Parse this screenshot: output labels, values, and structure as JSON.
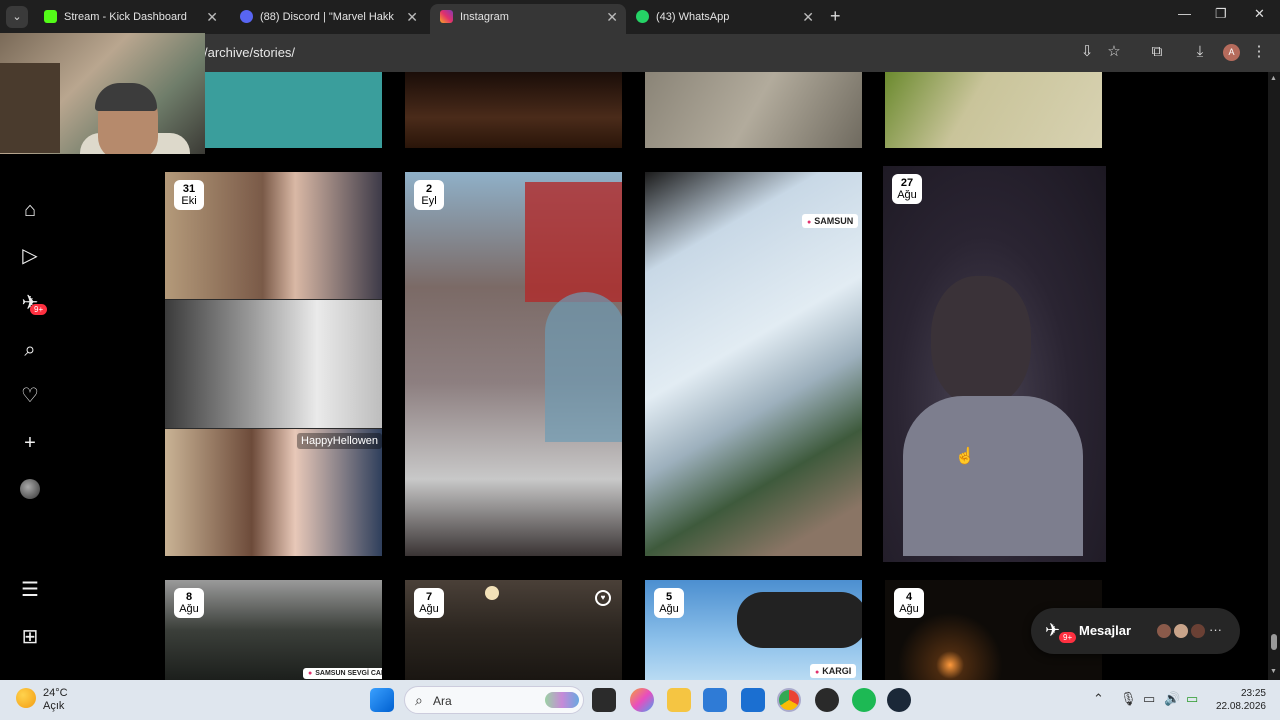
{
  "browser": {
    "tabs": [
      {
        "title": "Stream - Kick Dashboard",
        "fav_color": "#53fc18",
        "fav_text": "K"
      },
      {
        "title": "(88) Discord | \"Marvel Hakk",
        "fav_color": "#5865f2",
        "fav_text": "88"
      },
      {
        "title": "Instagram",
        "fav_color": "#e1306c",
        "fav_text": "◎"
      },
      {
        "title": "(43) WhatsApp",
        "fav_color": "#25d366",
        "fav_text": "✆"
      }
    ],
    "url": "/archive/stories/",
    "profile_initial": "A"
  },
  "stories": [
    {
      "day": "31",
      "month": "Eki",
      "caption": "HappyHellowen"
    },
    {
      "day": "2",
      "month": "Eyl"
    },
    {
      "location": "SAMSUN"
    },
    {
      "day": "27",
      "month": "Ağu"
    },
    {
      "day": "8",
      "month": "Ağu",
      "location": "SAMSUN SEVGİ CAFE"
    },
    {
      "day": "7",
      "month": "Ağu"
    },
    {
      "day": "5",
      "month": "Ağu",
      "location": "KARGI"
    },
    {
      "day": "4",
      "month": "Ağu"
    }
  ],
  "messages": {
    "label": "Mesajlar",
    "badge": "9+"
  },
  "nav": {
    "notifications_badge": "9+"
  },
  "taskbar": {
    "temp": "24°C",
    "condition": "Açık",
    "search_placeholder": "Ara",
    "time": "23:25",
    "date": "22.08.2026"
  }
}
